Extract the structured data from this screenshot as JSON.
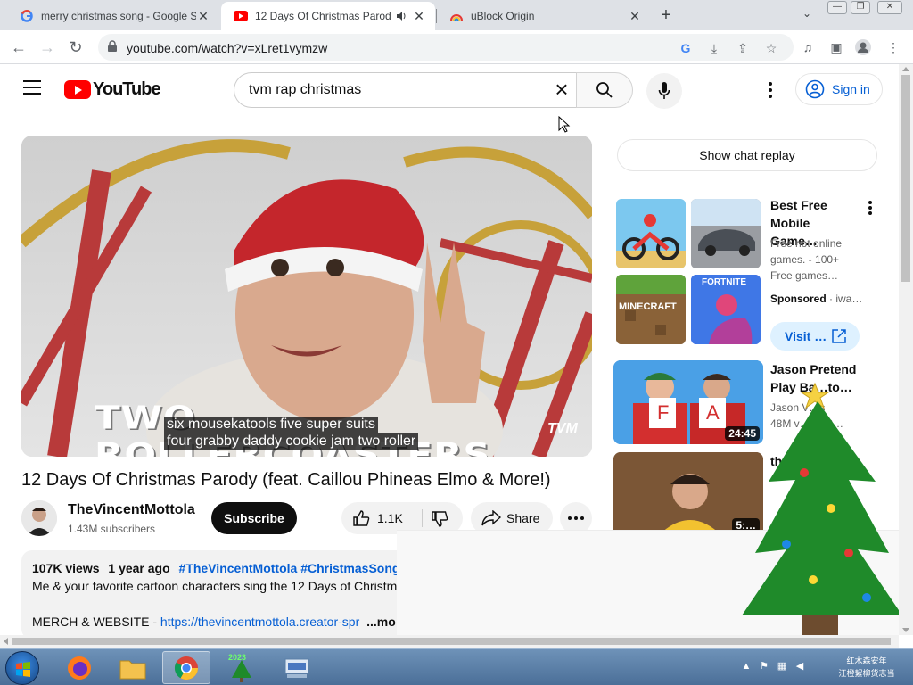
{
  "browser": {
    "tabs": [
      {
        "title": "merry christmas song - Google S",
        "favicon": "google-icon"
      },
      {
        "title": "12 Days Of Christmas Parod",
        "favicon": "youtube-icon",
        "audio": true
      },
      {
        "title": "uBlock Origin",
        "favicon": "rainbow-icon"
      }
    ],
    "url": "youtube.com/watch?v=xLret1vymzw"
  },
  "youtube": {
    "logo_text": "YouTube",
    "search_query": "tvm rap christmas",
    "sign_in": "Sign in",
    "video": {
      "overlay_text": "TWO ROLLERCOASTERS",
      "brand": "TVM",
      "caption_line1": "six mousekatools five super suits",
      "caption_line2": "four grabby daddy cookie jam two roller",
      "title": "12 Days Of Christmas Parody (feat. Caillou Phineas Elmo & More!)",
      "channel": "TheVincentMottola",
      "subscribers": "1.43M subscribers",
      "subscribe": "Subscribe",
      "likes": "1.1K",
      "share": "Share"
    },
    "description": {
      "views": "107K views",
      "age": "1 year ago",
      "hashtags": "#TheVincentMottola #ChristmasSongs #",
      "line1": "Me & your favorite cartoon characters sing the 12 Days of Christm",
      "merch_label": "MERCH & WEBSITE - ",
      "merch_link": "https://thevincentmottola.creator-spr",
      "more": "...mo"
    },
    "sidebar": {
      "show_chat_replay": "Show chat replay",
      "ad": {
        "title": "Best Free Mobile Game…",
        "desc": "Free hot online games. - 100+ Free games…",
        "sponsored": "Sponsored",
        "advertiser": "iwa…",
        "visit": "Visit …",
        "tiles": [
          "MINECRAFT",
          "FORTNITE"
        ]
      },
      "videos": [
        {
          "title": "Jason Pretend Play Ba…to…",
          "channel": "Jason V…s",
          "views": "48M v… … 2…",
          "duration": "24:45",
          "letters": [
            "F",
            "A"
          ]
        },
        {
          "title": "th…",
          "duration": "5:…"
        }
      ]
    }
  },
  "taskbar": {
    "tree_label": "2023",
    "clock_line1": "红木森安年",
    "clock_line2": "汪橙絜柳货志当"
  },
  "colors": {
    "yt_red": "#ff0000",
    "link_blue": "#065fd4",
    "taskbar": "#5a7fa8"
  }
}
